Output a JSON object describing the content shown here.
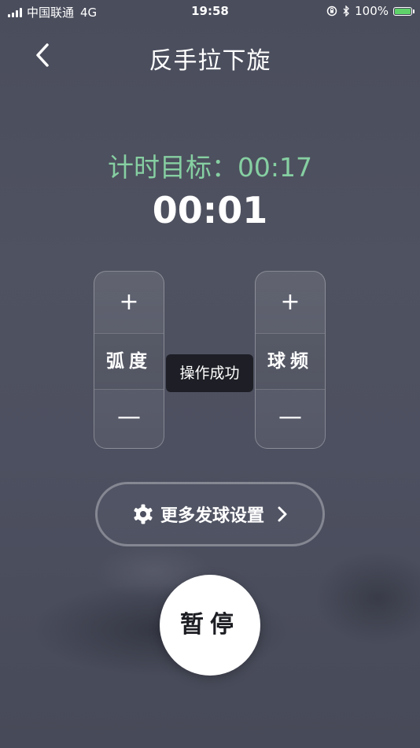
{
  "status_bar": {
    "carrier": "中国联通",
    "network": "4G",
    "time": "19:58",
    "battery": "100%"
  },
  "header": {
    "title": "反手拉下旋",
    "back_icon": "chevron-left-icon"
  },
  "timer": {
    "target": "计时目标：00:17",
    "elapsed": "00:01"
  },
  "controls": {
    "arc": {
      "plus": "+",
      "label": "弧度",
      "minus": "—"
    },
    "frequency": {
      "plus": "+",
      "label": "球频",
      "minus": "—"
    }
  },
  "toast": "操作成功",
  "more_settings": {
    "label": "更多发球设置",
    "icon": "gear-icon"
  },
  "pause_button": "暂停",
  "colors": {
    "accent_green": "#86cfa2",
    "battery_green": "#5fd36a",
    "background": "#4d5060"
  }
}
